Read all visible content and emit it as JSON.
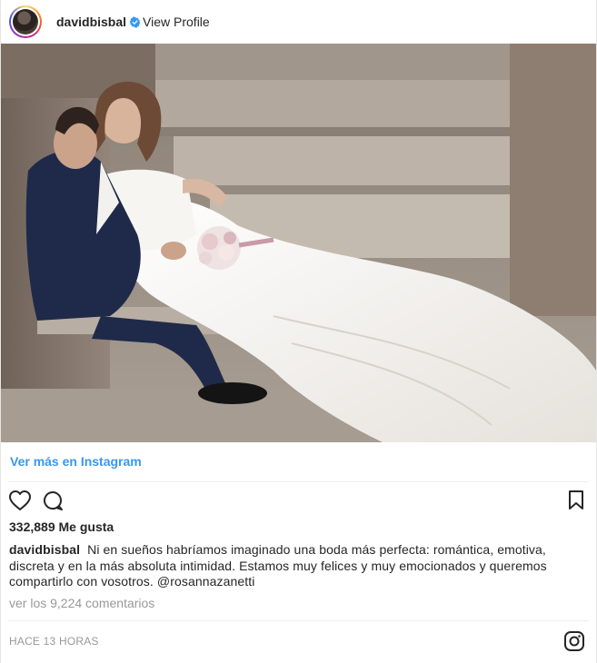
{
  "header": {
    "username": "davidbisbal",
    "view_profile": "View Profile",
    "verified_icon": "verified-badge-icon"
  },
  "photo": {
    "description_colors": {
      "stone": "#b9afa5",
      "dress": "#f4f2ef",
      "suit": "#1f2a4a"
    }
  },
  "links": {
    "ver_mas": "Ver más en Instagram"
  },
  "actions": {
    "icons": [
      "heart-icon",
      "comment-icon",
      "bookmark-icon"
    ]
  },
  "likes": "332,889 Me gusta",
  "caption": {
    "user": "davidbisbal",
    "text": "Ni en sueños habríamos imaginado una boda más perfecta: romántica, emotiva, discreta y en la más absoluta intimidad. Estamos muy felices y muy emocionados y queremos compartirlo con vosotros.",
    "mention": "@rosannazanetti"
  },
  "comments_link": "ver los 9,224 comentarios",
  "timestamp": "HACE 13 HORAS",
  "colors": {
    "link": "#3897f0",
    "muted": "#999999",
    "text": "#262626"
  }
}
